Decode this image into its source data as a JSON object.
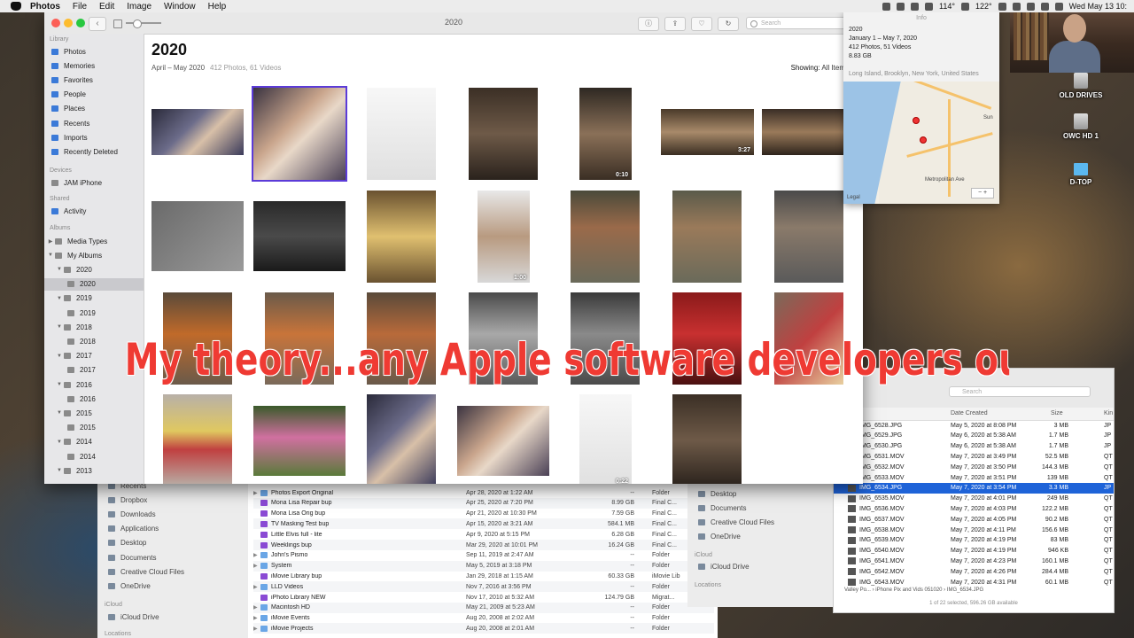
{
  "menubar": {
    "app_name": "Photos",
    "items": [
      "File",
      "Edit",
      "Image",
      "Window",
      "Help"
    ],
    "status_texts": [
      "114°",
      "122°"
    ],
    "clock": "Wed May 13 10:"
  },
  "photos": {
    "window_title": "2020",
    "search_placeholder": "Search",
    "sidebar": {
      "sections": [
        "Library",
        "Devices",
        "Shared",
        "Albums"
      ],
      "library_items": [
        "Photos",
        "Memories",
        "Favorites",
        "People",
        "Places",
        "Recents",
        "Imports",
        "Recently Deleted"
      ],
      "device_items": [
        "JAM iPhone"
      ],
      "shared_items": [
        "Activity"
      ],
      "album_items": [
        "Media Types",
        "My Albums",
        "2020",
        "2020",
        "2019",
        "2019",
        "2018",
        "2018",
        "2017",
        "2017",
        "2016",
        "2016",
        "2015",
        "2015",
        "2014",
        "2014",
        "2013"
      ]
    },
    "content": {
      "title": "2020",
      "date_range": "April – May 2020",
      "counts": "412 Photos, 61 Videos",
      "showing_label": "Showing:",
      "showing_value": "All Item"
    },
    "video_durations": [
      "3:27",
      "0:10",
      "1:00",
      "0:22"
    ]
  },
  "info_panel": {
    "title": "Info",
    "album": "2020",
    "dates": "January 1 – May 7, 2020",
    "counts": "412 Photos, 51 Videos",
    "size": "8.83 GB",
    "location": "Long Island, Brooklyn, New York, United States",
    "map_labels": [
      "Sun",
      "Metropolitan Ave",
      "Legal"
    ],
    "zoom": "−  +"
  },
  "desktop_drives": [
    "OLD DRIVES",
    "OWC HD 1",
    "D-TOP"
  ],
  "caption": "My theory...any Apple software developers out there?",
  "finder": {
    "sidebar_items": [
      "Recents",
      "Dropbox",
      "Downloads",
      "Applications",
      "Desktop",
      "Documents",
      "Creative Cloud Files",
      "OneDrive"
    ],
    "sidebar_sections": [
      "iCloud",
      "Locations"
    ],
    "icloud_items": [
      "iCloud Drive"
    ],
    "rows": [
      {
        "name": "Photos Export Original",
        "date": "Apr 28, 2020 at 1:22 AM",
        "size": "--",
        "kind": "Folder"
      },
      {
        "name": "Mona Lisa Repair bup",
        "date": "Apr 25, 2020 at 7:20 PM",
        "size": "8.99 GB",
        "kind": "Final C..."
      },
      {
        "name": "Mona Lisa Orig bup",
        "date": "Apr 21, 2020 at 10:30 PM",
        "size": "7.59 GB",
        "kind": "Final C..."
      },
      {
        "name": "TV Masking Test bup",
        "date": "Apr 15, 2020 at 3:21 AM",
        "size": "584.1 MB",
        "kind": "Final C..."
      },
      {
        "name": "Little Elvis full - lite",
        "date": "Apr 9, 2020 at 5:15 PM",
        "size": "6.28 GB",
        "kind": "Final C..."
      },
      {
        "name": "Weeklings bup",
        "date": "Mar 29, 2020 at 10:01 PM",
        "size": "16.24 GB",
        "kind": "Final C..."
      },
      {
        "name": "John's Pismo",
        "date": "Sep 11, 2019 at 2:47 AM",
        "size": "--",
        "kind": "Folder"
      },
      {
        "name": "System",
        "date": "May 5, 2019 at 3:18 PM",
        "size": "--",
        "kind": "Folder"
      },
      {
        "name": "iMovie Library bup",
        "date": "Jan 29, 2018 at 1:15 AM",
        "size": "60.33 GB",
        "kind": "iMovie Lib"
      },
      {
        "name": "LLD Videos",
        "date": "Nov 7, 2016 at 3:56 PM",
        "size": "--",
        "kind": "Folder"
      },
      {
        "name": "iPhoto Library NEW",
        "date": "Nov 17, 2010 at 5:32 AM",
        "size": "124.79 GB",
        "kind": "Migrat..."
      },
      {
        "name": "Macintosh HD",
        "date": "May 21, 2009 at 5:23 AM",
        "size": "--",
        "kind": "Folder"
      },
      {
        "name": "iMovie Events",
        "date": "Aug 20, 2008 at 2:02 AM",
        "size": "--",
        "kind": "Folder"
      },
      {
        "name": "iMovie Projects",
        "date": "Aug 20, 2008 at 2:01 AM",
        "size": "--",
        "kind": "Folder"
      }
    ]
  },
  "finder2": {
    "items": [
      "Desktop",
      "Documents",
      "Creative Cloud Files",
      "OneDrive"
    ],
    "sections": [
      "iCloud",
      "Locations"
    ],
    "icloud_items": [
      "iCloud Drive"
    ]
  },
  "filelist": {
    "search_placeholder": "Search",
    "col_date": "Date Created",
    "col_size": "Size",
    "col_kind": "Kin",
    "rows": [
      {
        "name": "IMG_6528.JPG",
        "date": "May 5, 2020 at 8:08 PM",
        "size": "3 MB",
        "kind": "JP"
      },
      {
        "name": "IMG_6529.JPG",
        "date": "May 6, 2020 at 5:38 AM",
        "size": "1.7 MB",
        "kind": "JP"
      },
      {
        "name": "IMG_6530.JPG",
        "date": "May 6, 2020 at 5:38 AM",
        "size": "1.7 MB",
        "kind": "JP"
      },
      {
        "name": "IMG_6531.MOV",
        "date": "May 7, 2020 at 3:49 PM",
        "size": "52.5 MB",
        "kind": "QT"
      },
      {
        "name": "IMG_6532.MOV",
        "date": "May 7, 2020 at 3:50 PM",
        "size": "144.3 MB",
        "kind": "QT"
      },
      {
        "name": "IMG_6533.MOV",
        "date": "May 7, 2020 at 3:51 PM",
        "size": "139 MB",
        "kind": "QT"
      },
      {
        "name": "IMG_6534.JPG",
        "date": "May 7, 2020 at 3:54 PM",
        "size": "3.3 MB",
        "kind": "JP"
      },
      {
        "name": "IMG_6535.MOV",
        "date": "May 7, 2020 at 4:01 PM",
        "size": "249 MB",
        "kind": "QT"
      },
      {
        "name": "IMG_6536.MOV",
        "date": "May 7, 2020 at 4:03 PM",
        "size": "122.2 MB",
        "kind": "QT"
      },
      {
        "name": "IMG_6537.MOV",
        "date": "May 7, 2020 at 4:05 PM",
        "size": "90.2 MB",
        "kind": "QT"
      },
      {
        "name": "IMG_6538.MOV",
        "date": "May 7, 2020 at 4:11 PM",
        "size": "156.6 MB",
        "kind": "QT"
      },
      {
        "name": "IMG_6539.MOV",
        "date": "May 7, 2020 at 4:19 PM",
        "size": "83 MB",
        "kind": "QT"
      },
      {
        "name": "IMG_6540.MOV",
        "date": "May 7, 2020 at 4:19 PM",
        "size": "946 KB",
        "kind": "QT"
      },
      {
        "name": "IMG_6541.MOV",
        "date": "May 7, 2020 at 4:23 PM",
        "size": "160.1 MB",
        "kind": "QT"
      },
      {
        "name": "IMG_6542.MOV",
        "date": "May 7, 2020 at 4:26 PM",
        "size": "284.4 MB",
        "kind": "QT"
      },
      {
        "name": "IMG_6543.MOV",
        "date": "May 7, 2020 at 4:31 PM",
        "size": "60.1 MB",
        "kind": "QT"
      }
    ],
    "path": "Valley Po... › iPhone Pix and Vids 051020 › IMG_6534.JPG",
    "status": "1 of 22 selected, 596.26 GB available"
  },
  "colors": {
    "selection_blue": "#1e63d8",
    "photo_select_outline": "#5b3bd8",
    "caption_red": "#ef3a33"
  }
}
